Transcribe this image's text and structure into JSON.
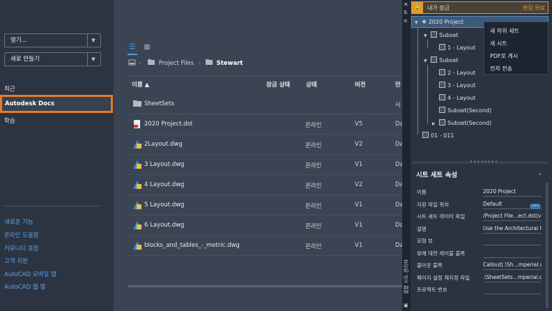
{
  "sidebar": {
    "open_label": "열기...",
    "new_label": "새로 만들기",
    "nav_recent": "최근",
    "nav_docs": "Autodesk Docs",
    "nav_learn": "학습",
    "links": [
      "새로운 기능",
      "온라인 도움말",
      "커뮤니티 포럼",
      "고객 지원",
      "AutoCAD 모바일 앱",
      "AutoCAD 웹 앱"
    ]
  },
  "breadcrumb": {
    "folder1": "Project Files",
    "folder2": "Stewart"
  },
  "table": {
    "headers": {
      "name": "이름",
      "lock": "잠금 상태",
      "state": "상태",
      "version": "버전",
      "date": "만"
    },
    "rows": [
      {
        "name": "SheetSets",
        "state": "",
        "version": "",
        "date": "사",
        "icon": "folder-icon"
      },
      {
        "name": "2020 Project.dst",
        "state": "온라인",
        "version": "V5",
        "date": "Da",
        "icon": "dst-file-icon"
      },
      {
        "name": "2Layout.dwg",
        "state": "온라인",
        "version": "V2",
        "date": "Da",
        "icon": "dwg-file-icon"
      },
      {
        "name": "3 Layout.dwg",
        "state": "온라인",
        "version": "V1",
        "date": "Da",
        "icon": "dwg-file-icon"
      },
      {
        "name": "4 Layout.dwg",
        "state": "온라인",
        "version": "V2",
        "date": "Da",
        "icon": "dwg-file-icon"
      },
      {
        "name": "5 Layout.dwg",
        "state": "온라인",
        "version": "V1",
        "date": "Da",
        "icon": "dwg-file-icon"
      },
      {
        "name": "6 Layout.dwg",
        "state": "온라인",
        "version": "V1",
        "date": "Da",
        "icon": "dwg-file-icon"
      },
      {
        "name": "blocks_and_tables_-_metric.dwg",
        "state": "온라인",
        "version": "V1",
        "date": "Da",
        "icon": "dwg-file-icon"
      }
    ]
  },
  "sheetset": {
    "lock_label": "내가 잠금",
    "done_label": "편집 완료",
    "palette_title": "결합 시트 관리자",
    "tree": {
      "root": "2020 Project",
      "subset1": "Subset",
      "layout1": "1 - Layout",
      "subset2": "Subset",
      "layout2": "2 - Layout",
      "layout3": "3 - Layout",
      "layout4": "4 - Layout",
      "subset_second_1": "Subset(Second)",
      "subset_second_2": "Subset(Second)",
      "sheet_011": "01 - 011"
    },
    "context_menu": [
      "새 하위 세트",
      "새 시트",
      "PDF로 게시",
      "전자 전송"
    ],
    "props_title": "시트 세트 속성",
    "props": [
      {
        "label": "이름",
        "value": "2020 Project"
      },
      {
        "label": "지원 파일 위치",
        "value": "Default"
      },
      {
        "label": "시트 세트 데이터 파일",
        "value": "/Project File...ect.dst(v1.1)"
      },
      {
        "label": "설명",
        "value": "Use the Architectural Imperial"
      },
      {
        "label": "모형 뷰",
        "value": ""
      },
      {
        "label": "뷰에 대한 레이블 블록",
        "value": ""
      },
      {
        "label": "콜아웃 블록",
        "value": "Callout(.\\Sh...mperial.dwt)"
      },
      {
        "label": "페이지 설정 재지정 파일",
        "value": ".\\SheetSets...mperial.dwt"
      },
      {
        "label": "프로젝트 번호",
        "value": ""
      }
    ]
  }
}
